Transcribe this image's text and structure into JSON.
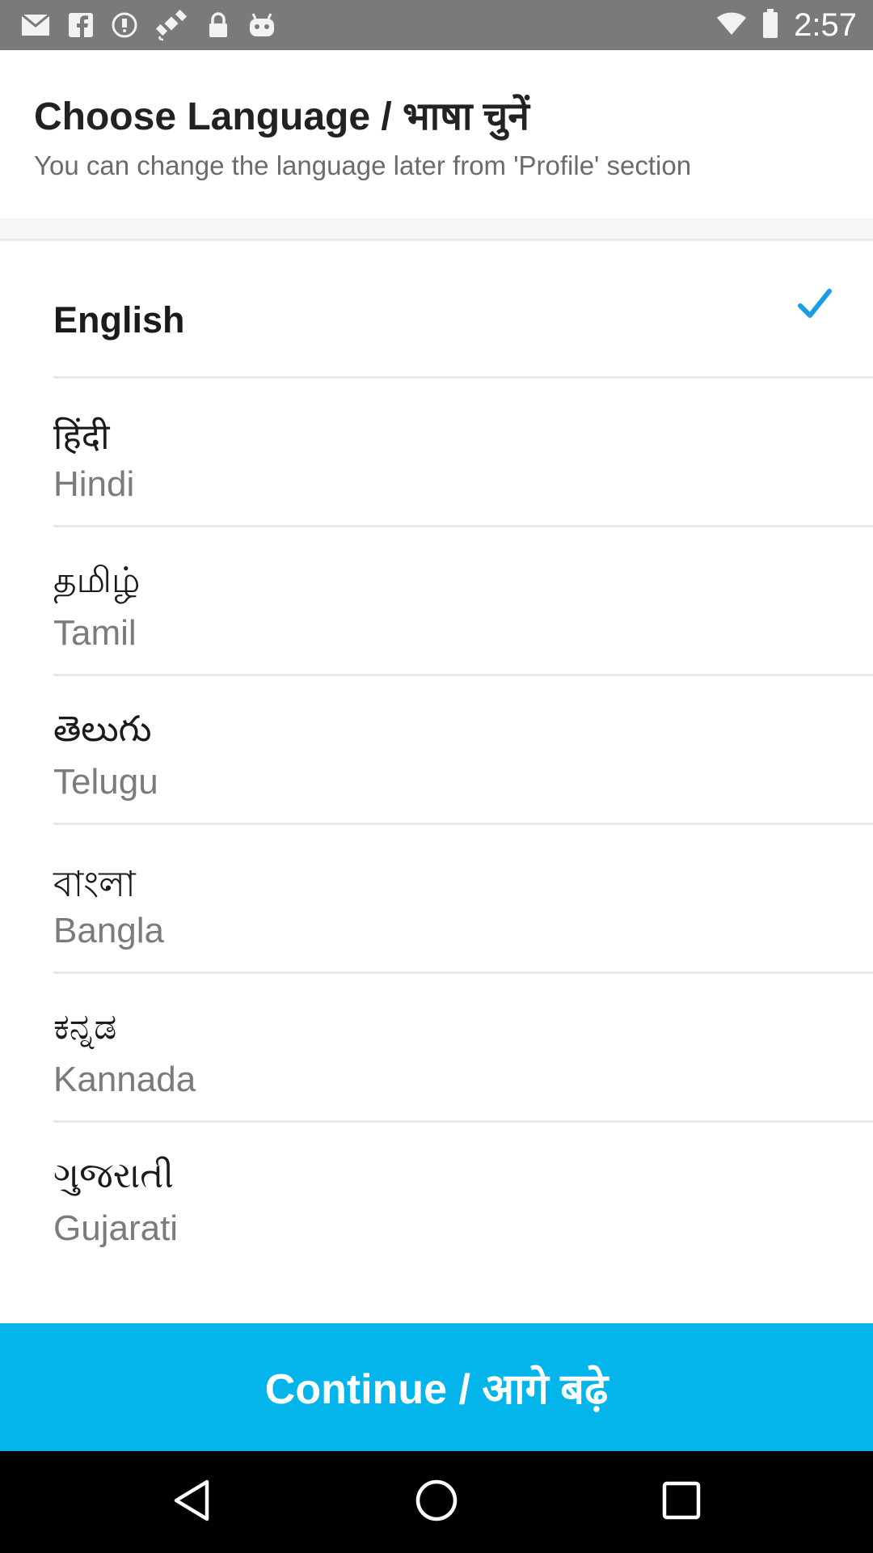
{
  "status_bar": {
    "time": "2:57",
    "icons": [
      "mail-icon",
      "facebook-icon",
      "cast-icon",
      "satellite-icon",
      "lock-icon",
      "robot-icon",
      "wifi-icon",
      "battery-icon"
    ]
  },
  "header": {
    "title": "Choose Language / भाषा चुनें",
    "subtitle": "You can change the language later from 'Profile' section"
  },
  "languages": [
    {
      "label": "English",
      "selected": true
    },
    {
      "native": "हिंदी",
      "label": "Hindi",
      "selected": false
    },
    {
      "native": "தமிழ்",
      "label": "Tamil",
      "selected": false
    },
    {
      "native": "తెలుగు",
      "label": "Telugu",
      "selected": false
    },
    {
      "native": "বাংলা",
      "label": "Bangla",
      "selected": false
    },
    {
      "native": "ಕನ್ನಡ",
      "label": "Kannada",
      "selected": false
    },
    {
      "native": "ગુજરાતી",
      "label": "Gujarati",
      "selected": false
    }
  ],
  "continue_button": {
    "label": "Continue / आगे बढ़े"
  },
  "colors": {
    "accent": "#03b5ea",
    "status_bar": "#7a7a7a",
    "check": "#1a9ee6"
  },
  "navigation": [
    "back-icon",
    "home-icon",
    "recent-apps-icon"
  ]
}
